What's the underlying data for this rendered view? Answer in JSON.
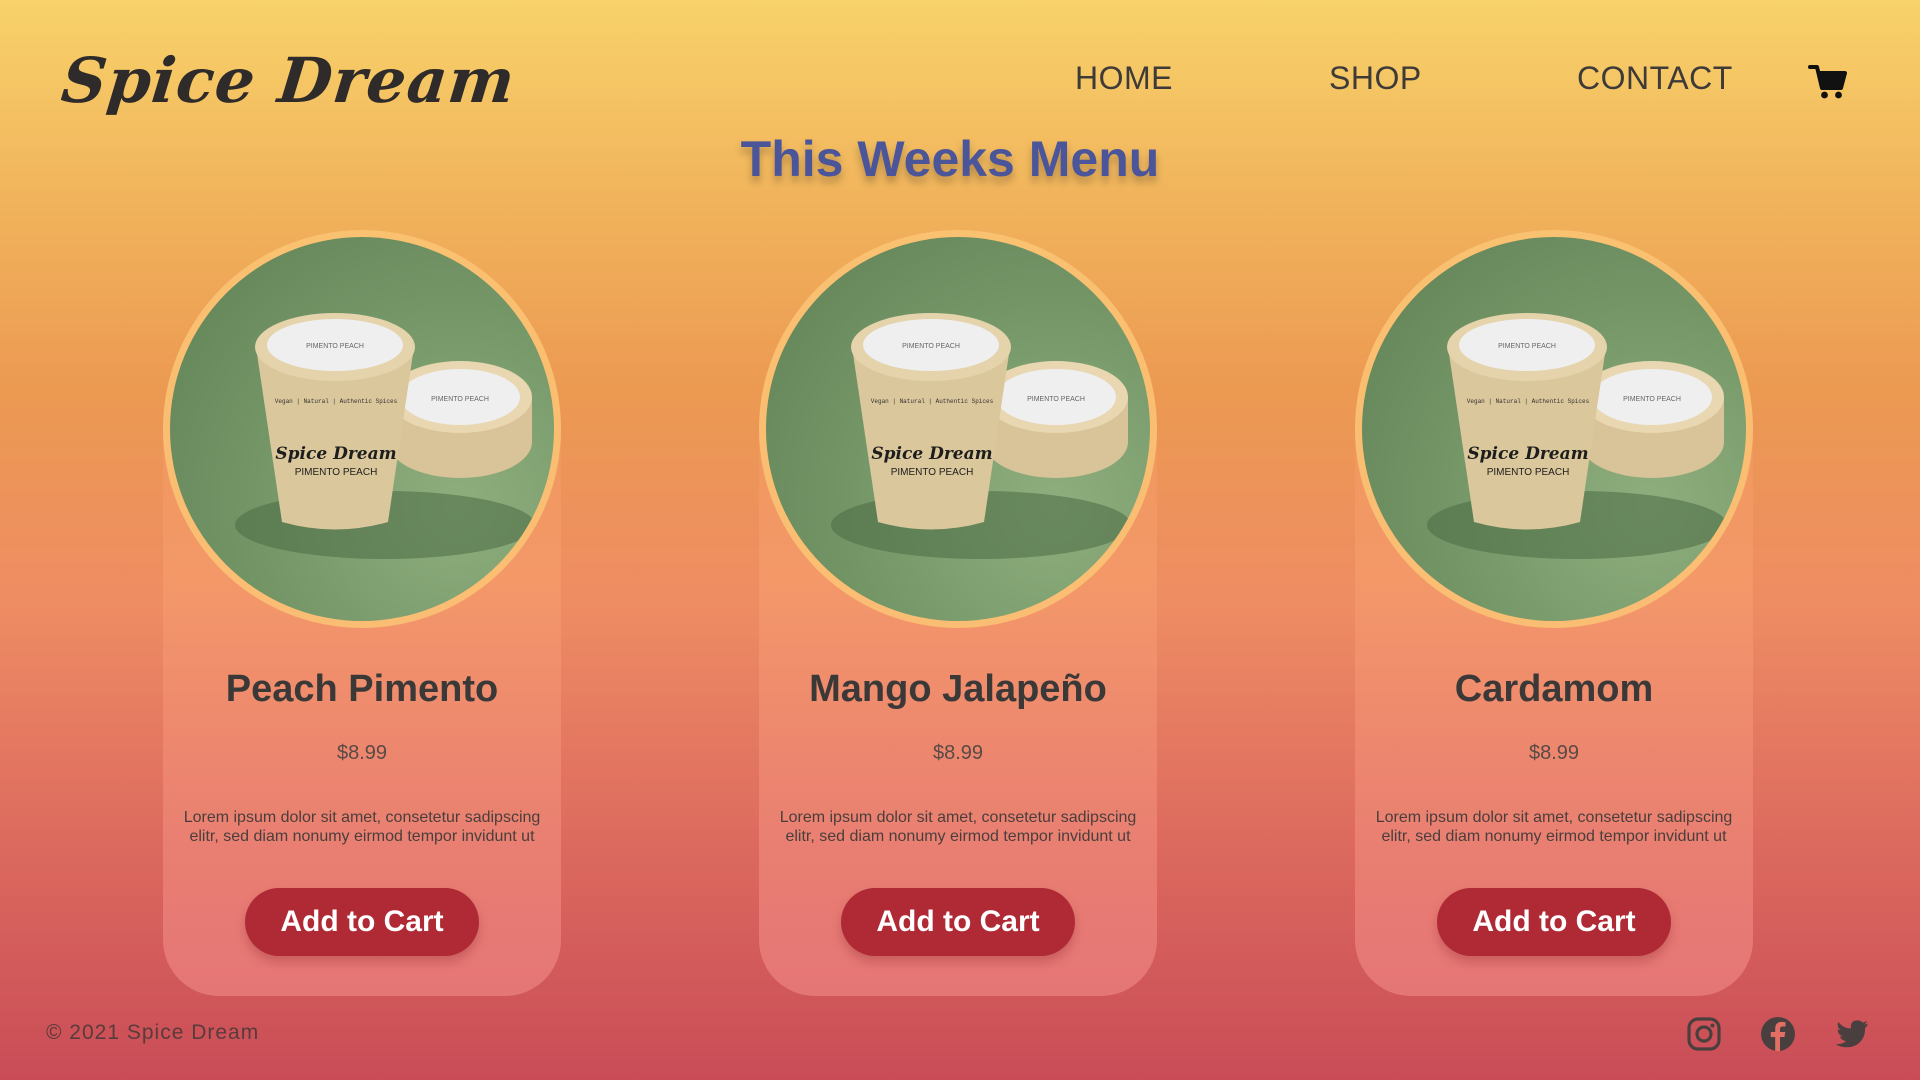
{
  "brand": {
    "name": "Spice Dream"
  },
  "nav": {
    "items": [
      {
        "label": "HOME"
      },
      {
        "label": "SHOP"
      },
      {
        "label": "CONTACT"
      }
    ],
    "cart_icon": "shopping-cart-icon"
  },
  "menu": {
    "title": "This Weeks Menu",
    "products": [
      {
        "name": "Peach Pimento",
        "price": "$8.99",
        "description": "Lorem ipsum dolor sit amet, consetetur sadipscing elitr, sed diam nonumy eirmod tempor invidunt ut",
        "button_label": "Add to Cart",
        "package_lid_text": "PIMENTO PEACH",
        "package_brand": "Spice Dream",
        "package_flavor": "PIMENTO PEACH",
        "package_tagline": "Vegan | Natural | Authentic Spices"
      },
      {
        "name": "Mango Jalapeño",
        "price": "$8.99",
        "description": "Lorem ipsum dolor sit amet, consetetur sadipscing elitr, sed diam nonumy eirmod tempor invidunt ut",
        "button_label": "Add to Cart",
        "package_lid_text": "PIMENTO PEACH",
        "package_brand": "Spice Dream",
        "package_flavor": "PIMENTO PEACH",
        "package_tagline": "Vegan | Natural | Authentic Spices"
      },
      {
        "name": "Cardamom",
        "price": "$8.99",
        "description": "Lorem ipsum dolor sit amet, consetetur sadipscing elitr, sed diam nonumy eirmod tempor invidunt ut",
        "button_label": "Add to Cart",
        "package_lid_text": "PIMENTO PEACH",
        "package_brand": "Spice Dream",
        "package_flavor": "PIMENTO PEACH",
        "package_tagline": "Vegan | Natural | Authentic Spices"
      }
    ]
  },
  "footer": {
    "copyright": "© 2021 Spice Dream",
    "social_icons": [
      "instagram-icon",
      "facebook-icon",
      "twitter-icon"
    ]
  },
  "colors": {
    "title_blue": "#4b559a",
    "button_red": "#b02a36",
    "photo_green": "#7a9c6c"
  }
}
